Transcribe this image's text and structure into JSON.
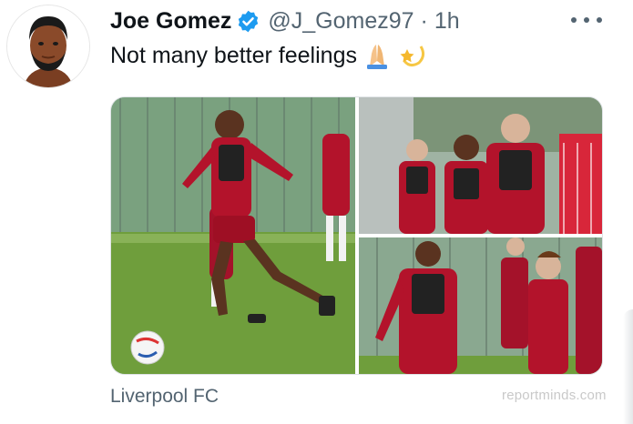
{
  "tweet": {
    "author_name": "Joe Gomez",
    "handle": "@J_Gomez97",
    "separator": "·",
    "time": "1h",
    "text": "Not many better feelings",
    "emojis": [
      "folded-hands-emoji",
      "dizzy-star-emoji"
    ],
    "media_source": "Liverpool FC"
  },
  "watermark": "reportminds.com",
  "colors": {
    "verified": "#1d9bf0",
    "text": "#0f1419",
    "secondary": "#536471",
    "kit_red": "#b3132b",
    "grass": "#6f9e3c"
  }
}
